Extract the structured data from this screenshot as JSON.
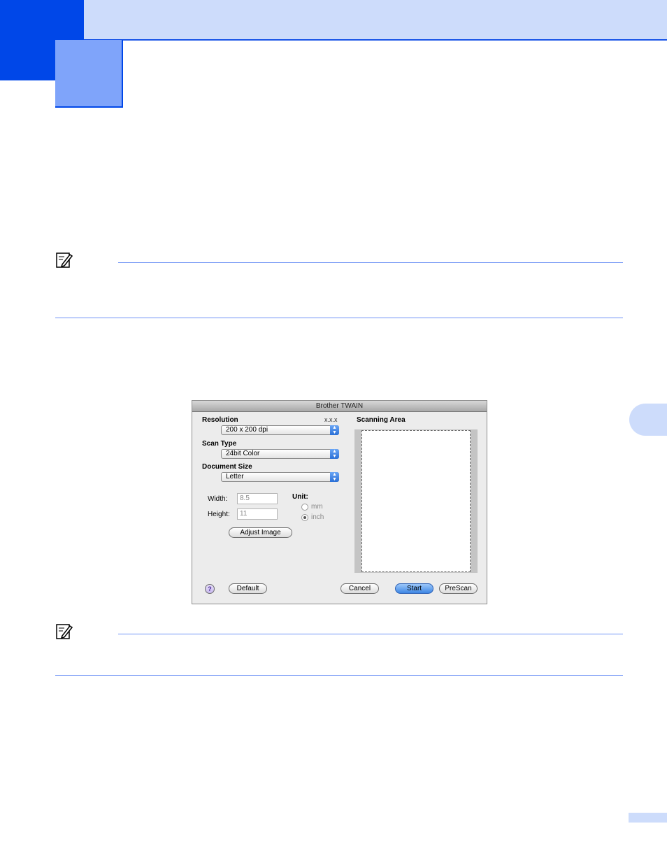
{
  "dialog": {
    "title": "Brother TWAIN",
    "version": "x.x.x",
    "resolution": {
      "label": "Resolution",
      "value": "200 x 200 dpi"
    },
    "scan_type": {
      "label": "Scan Type",
      "value": "24bit Color"
    },
    "document_size": {
      "label": "Document Size",
      "value": "Letter"
    },
    "width": {
      "label": "Width:",
      "value": "8.5"
    },
    "height": {
      "label": "Height:",
      "value": "11"
    },
    "unit": {
      "label": "Unit:",
      "options": [
        "mm",
        "inch"
      ],
      "selected": "inch"
    },
    "adjust_image_label": "Adjust Image",
    "scanning_area_label": "Scanning Area",
    "buttons": {
      "help": "?",
      "default": "Default",
      "cancel": "Cancel",
      "start": "Start",
      "prescan": "PreScan"
    }
  },
  "colors": {
    "accent": "#0047e8",
    "band": "#cddcfb",
    "chapter_box": "#7fa4fa",
    "rule": "#6f93f5"
  }
}
